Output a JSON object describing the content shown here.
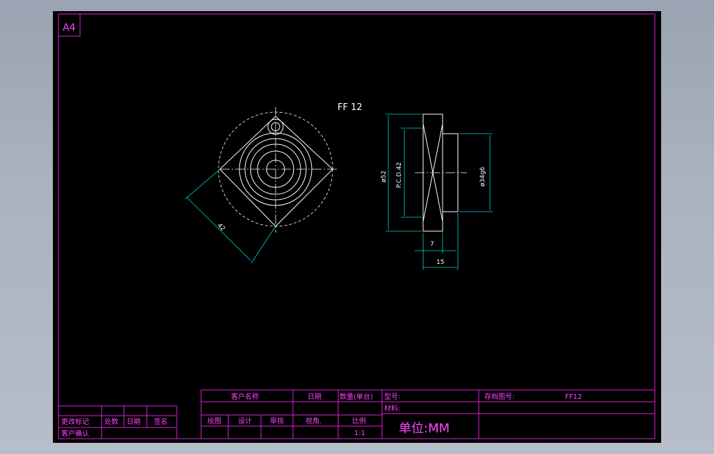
{
  "sheet": {
    "size_label": "A4",
    "part_title": "FF 12",
    "colors": {
      "border": "#e020e0",
      "text": "#ff44ff",
      "line": "#ffffff",
      "dimension": "#00d8d8",
      "background": "#000000"
    }
  },
  "dimensions": {
    "diag_width": "42",
    "outer_dia": "ø52",
    "pcd": "P.C.D.42",
    "shaft_dia": "ø34g6",
    "flange_thickness": "7",
    "total_length": "15"
  },
  "revision_block": {
    "header": [
      "更改标记",
      "处数",
      "日期",
      "签名"
    ],
    "customer_confirm": "客户确认"
  },
  "title_block": {
    "customer_name_label": "客户名称",
    "date_label": "日期",
    "quantity_label": "数量(单台)",
    "model_label": "型号:",
    "drawing_no_label": "存档图号:",
    "drawing_no_value": "FF12",
    "material_label": "材料:",
    "drawn_label": "绘图",
    "design_label": "设计",
    "review_label": "审核",
    "view_label": "视角.",
    "scale_label": "比例",
    "scale_value": "1:1",
    "unit_label": "单位:MM"
  }
}
